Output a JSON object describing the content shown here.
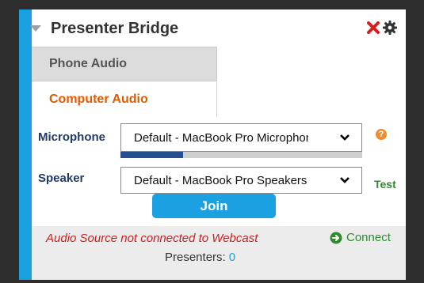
{
  "colors": {
    "accent": "#1ba1e2",
    "active_tab": "#e05a00",
    "error": "#cc1f1f",
    "success": "#2e8b2e",
    "help": "#f08c2a"
  },
  "header": {
    "title": "Presenter Bridge",
    "icons": [
      "collapse-triangle-icon",
      "close-icon",
      "gear-icon"
    ]
  },
  "tabs": [
    {
      "label": "Phone Audio",
      "active": false
    },
    {
      "label": "Computer Audio",
      "active": true
    }
  ],
  "audio": {
    "microphone_label": "Microphone",
    "microphone_value": "Default - MacBook Pro Microphone",
    "mic_level_fraction": 0.26,
    "speaker_label": "Speaker",
    "speaker_value": "Default - MacBook Pro Speakers",
    "test_label": "Test",
    "help_icon": "question-icon"
  },
  "join_label": "Join",
  "status": {
    "message": "Audio Source not connected to Webcast",
    "connect_label": "Connect",
    "presenters_label": "Presenters:",
    "presenters_count": "0"
  }
}
